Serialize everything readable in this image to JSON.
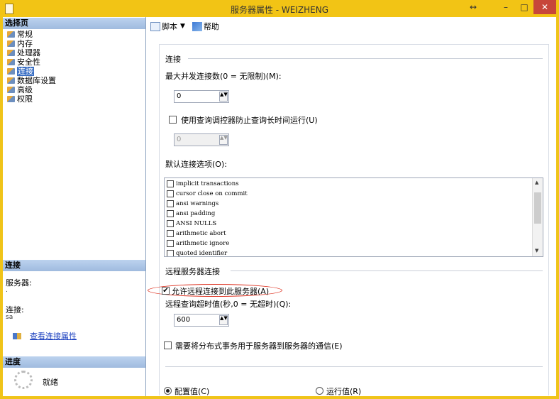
{
  "window": {
    "title": "服务器属性 - WEIZHENG",
    "resize_glyph": "↔",
    "minimize_glyph": "–",
    "maximize_glyph": "□",
    "close_glyph": "✕",
    "accent_color": "#f2c415",
    "close_color": "#c7463a"
  },
  "sidebar": {
    "pages_header": "选择页",
    "pages": [
      {
        "label": "常规",
        "icon": "page-icon"
      },
      {
        "label": "内存",
        "icon": "page-icon"
      },
      {
        "label": "处理器",
        "icon": "page-icon"
      },
      {
        "label": "安全性",
        "icon": "page-icon"
      },
      {
        "label": "连接",
        "icon": "page-icon",
        "selected": true
      },
      {
        "label": "数据库设置",
        "icon": "page-icon"
      },
      {
        "label": "高级",
        "icon": "page-icon"
      },
      {
        "label": "权限",
        "icon": "page-icon"
      }
    ],
    "connection_header": "连接",
    "server_label": "服务器:",
    "server_value": ".",
    "connection_label": "连接:",
    "connection_value": "sa",
    "view_link": "查看连接属性",
    "progress_header": "进度",
    "progress_status": "就绪"
  },
  "toolbar": {
    "script_label": "脚本",
    "script_caret": "▼",
    "help_label": "帮助"
  },
  "form": {
    "connections_group": "连接",
    "max_conn_label": "最大并发连接数(0 = 无限制)(M):",
    "max_conn_value": "0",
    "governor_label": "使用查询调控器防止查询长时间运行(U)",
    "governor_checked": false,
    "governor_value": "0",
    "default_options_label": "默认连接选项(O):",
    "default_options": [
      "implicit transactions",
      "cursor close on commit",
      "ansi warnings",
      "ansi padding",
      "ANSI NULLS",
      "arithmetic abort",
      "arithmetic ignore",
      "quoted identifier"
    ],
    "scroll_up": "▲",
    "scroll_down": "▼",
    "remote_group": "远程服务器连接",
    "allow_remote_label": "允许远程连接到此服务器(A)",
    "allow_remote_checked": true,
    "check_glyph": "✔",
    "remote_timeout_label": "远程查询超时值(秒,0 = 无超时)(Q):",
    "remote_timeout_value": "600",
    "distributed_label": "需要将分布式事务用于服务器到服务器的通信(E)",
    "distributed_checked": false,
    "config_value_label": "配置值(C)",
    "running_value_label": "运行值(R)",
    "selected_value_mode": "配置值(C)",
    "spin_glyph": "▲▼"
  }
}
